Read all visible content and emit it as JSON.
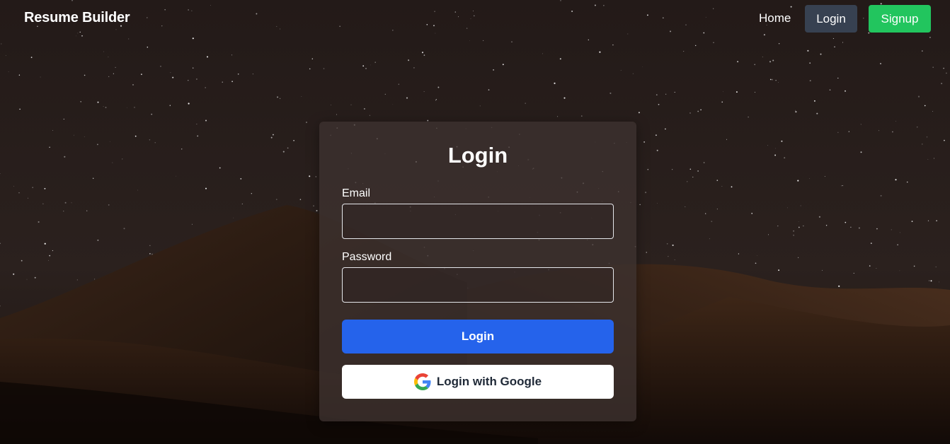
{
  "nav": {
    "brand": "Resume Builder",
    "home": "Home",
    "login": "Login",
    "signup": "Signup"
  },
  "form": {
    "title": "Login",
    "email_label": "Email",
    "email_value": "",
    "password_label": "Password",
    "password_value": "",
    "login_button": "Login",
    "google_button": "Login with Google",
    "google_icon": "google-logo-icon"
  },
  "colors": {
    "primary": "#2563eb",
    "signup": "#22c55e",
    "nav_login_bg": "#374151"
  }
}
